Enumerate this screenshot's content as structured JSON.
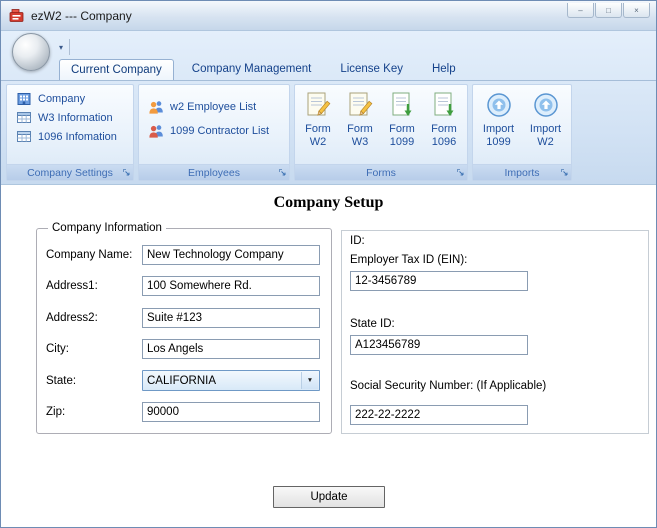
{
  "window": {
    "title": "ezW2 --- Company"
  },
  "icons": {
    "minimize": "–",
    "maximize": "□",
    "close": "×",
    "qat_dropdown": "▾",
    "chevron_down": "▼"
  },
  "ribbon": {
    "tabs": [
      {
        "label": "Current Company"
      },
      {
        "label": "Company Management"
      },
      {
        "label": "License Key"
      },
      {
        "label": "Help"
      }
    ],
    "groups": {
      "company_settings": {
        "label": "Company Settings",
        "items": [
          {
            "label": "Company",
            "icon": "company-building-icon"
          },
          {
            "label": "W3 Information",
            "icon": "w3-table-icon"
          },
          {
            "label": "1096 Infomation",
            "icon": "table-1096-icon"
          }
        ]
      },
      "employees": {
        "label": "Employees",
        "items": [
          {
            "label": "w2 Employee List",
            "icon": "employee-list-icon"
          },
          {
            "label": "1099 Contractor List",
            "icon": "contractor-list-icon"
          }
        ]
      },
      "forms": {
        "label": "Forms",
        "items": [
          {
            "line1": "Form",
            "line2": "W2",
            "icon": "form-w2-icon"
          },
          {
            "line1": "Form",
            "line2": "W3",
            "icon": "form-w3-icon"
          },
          {
            "line1": "Form",
            "line2": "1099",
            "icon": "form-1099-icon"
          },
          {
            "line1": "Form",
            "line2": "1096",
            "icon": "form-1096-icon"
          }
        ]
      },
      "imports": {
        "label": "Imports",
        "items": [
          {
            "line1": "Import",
            "line2": "1099",
            "icon": "import-1099-icon"
          },
          {
            "line1": "Import",
            "line2": "W2",
            "icon": "import-w2-icon"
          }
        ]
      }
    }
  },
  "main": {
    "title": "Company Setup",
    "company_info": {
      "legend": "Company Information",
      "fields": [
        {
          "label": "Company Name:",
          "value": "New Technology Company"
        },
        {
          "label": "Address1:",
          "value": "100 Somewhere Rd."
        },
        {
          "label": "Address2:",
          "value": "Suite #123"
        },
        {
          "label": "City:",
          "value": "Los Angels"
        },
        {
          "label": "State:",
          "value": "CALIFORNIA"
        },
        {
          "label": "Zip:",
          "value": "90000"
        }
      ]
    },
    "id_info": {
      "heading": "ID:",
      "fields": [
        {
          "label": "Employer Tax ID (EIN):",
          "value": "12-3456789"
        },
        {
          "label": "State ID:",
          "value": "A123456789"
        },
        {
          "label": "Social Security Number: (If Applicable)",
          "value": "222-22-2222"
        }
      ]
    },
    "update_button": "Update"
  },
  "colors": {
    "ribbon_item_text": "#1e4e9c",
    "group_label_text": "#3e6db5",
    "app_icon_red": "#d33b2f"
  }
}
